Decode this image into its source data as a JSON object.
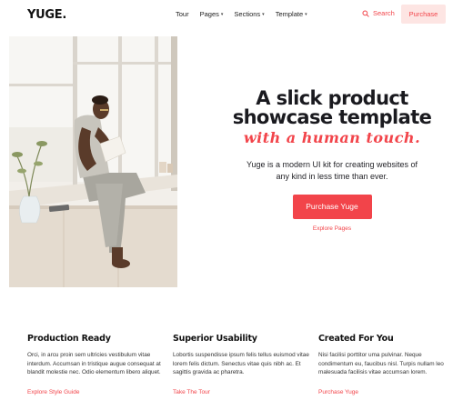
{
  "nav": {
    "logo": "YUGE.",
    "items": [
      {
        "label": "Tour",
        "dropdown": false
      },
      {
        "label": "Pages",
        "dropdown": true
      },
      {
        "label": "Sections",
        "dropdown": true
      },
      {
        "label": "Template",
        "dropdown": true
      }
    ],
    "search_label": "Search",
    "purchase_label": "Purchase"
  },
  "hero": {
    "headline_line1": "A slick product",
    "headline_line2": "showcase template",
    "script_line": "with a human touch.",
    "subtitle": "Yuge is a modern UI kit for creating websites of any kind in less time than ever.",
    "cta_label": "Purchase Yuge",
    "secondary_link": "Explore Pages"
  },
  "features": [
    {
      "title": "Production Ready",
      "body": "Orci, in arcu proin sem ultricies vestibulum vitae interdum. Accumsan in tristique augue consequat at blandit molestie nec. Odio elementum libero aliquet.",
      "link": "Explore Style Guide"
    },
    {
      "title": "Superior Usability",
      "body": "Lobortis suspendisse ipsum felis tellus euismod vitae lorem felis dictum. Senectus vitae quis nibh ac. Et sagittis gravida ac pharetra.",
      "link": "Take The Tour"
    },
    {
      "title": "Created For You",
      "body": "Nisi facilisi porttitor uma pulvinar. Neque condimentum eu, faucibus nisl. Turpis nullam leo malesuada facilisis vitae accumsan lorem.",
      "link": "Purchase Yuge"
    }
  ],
  "colors": {
    "accent": "#f2444a",
    "accent_soft": "#fde5e3",
    "text": "#1f1f24"
  },
  "icons": {
    "search": "search-icon",
    "caret": "chevron-down-icon"
  }
}
